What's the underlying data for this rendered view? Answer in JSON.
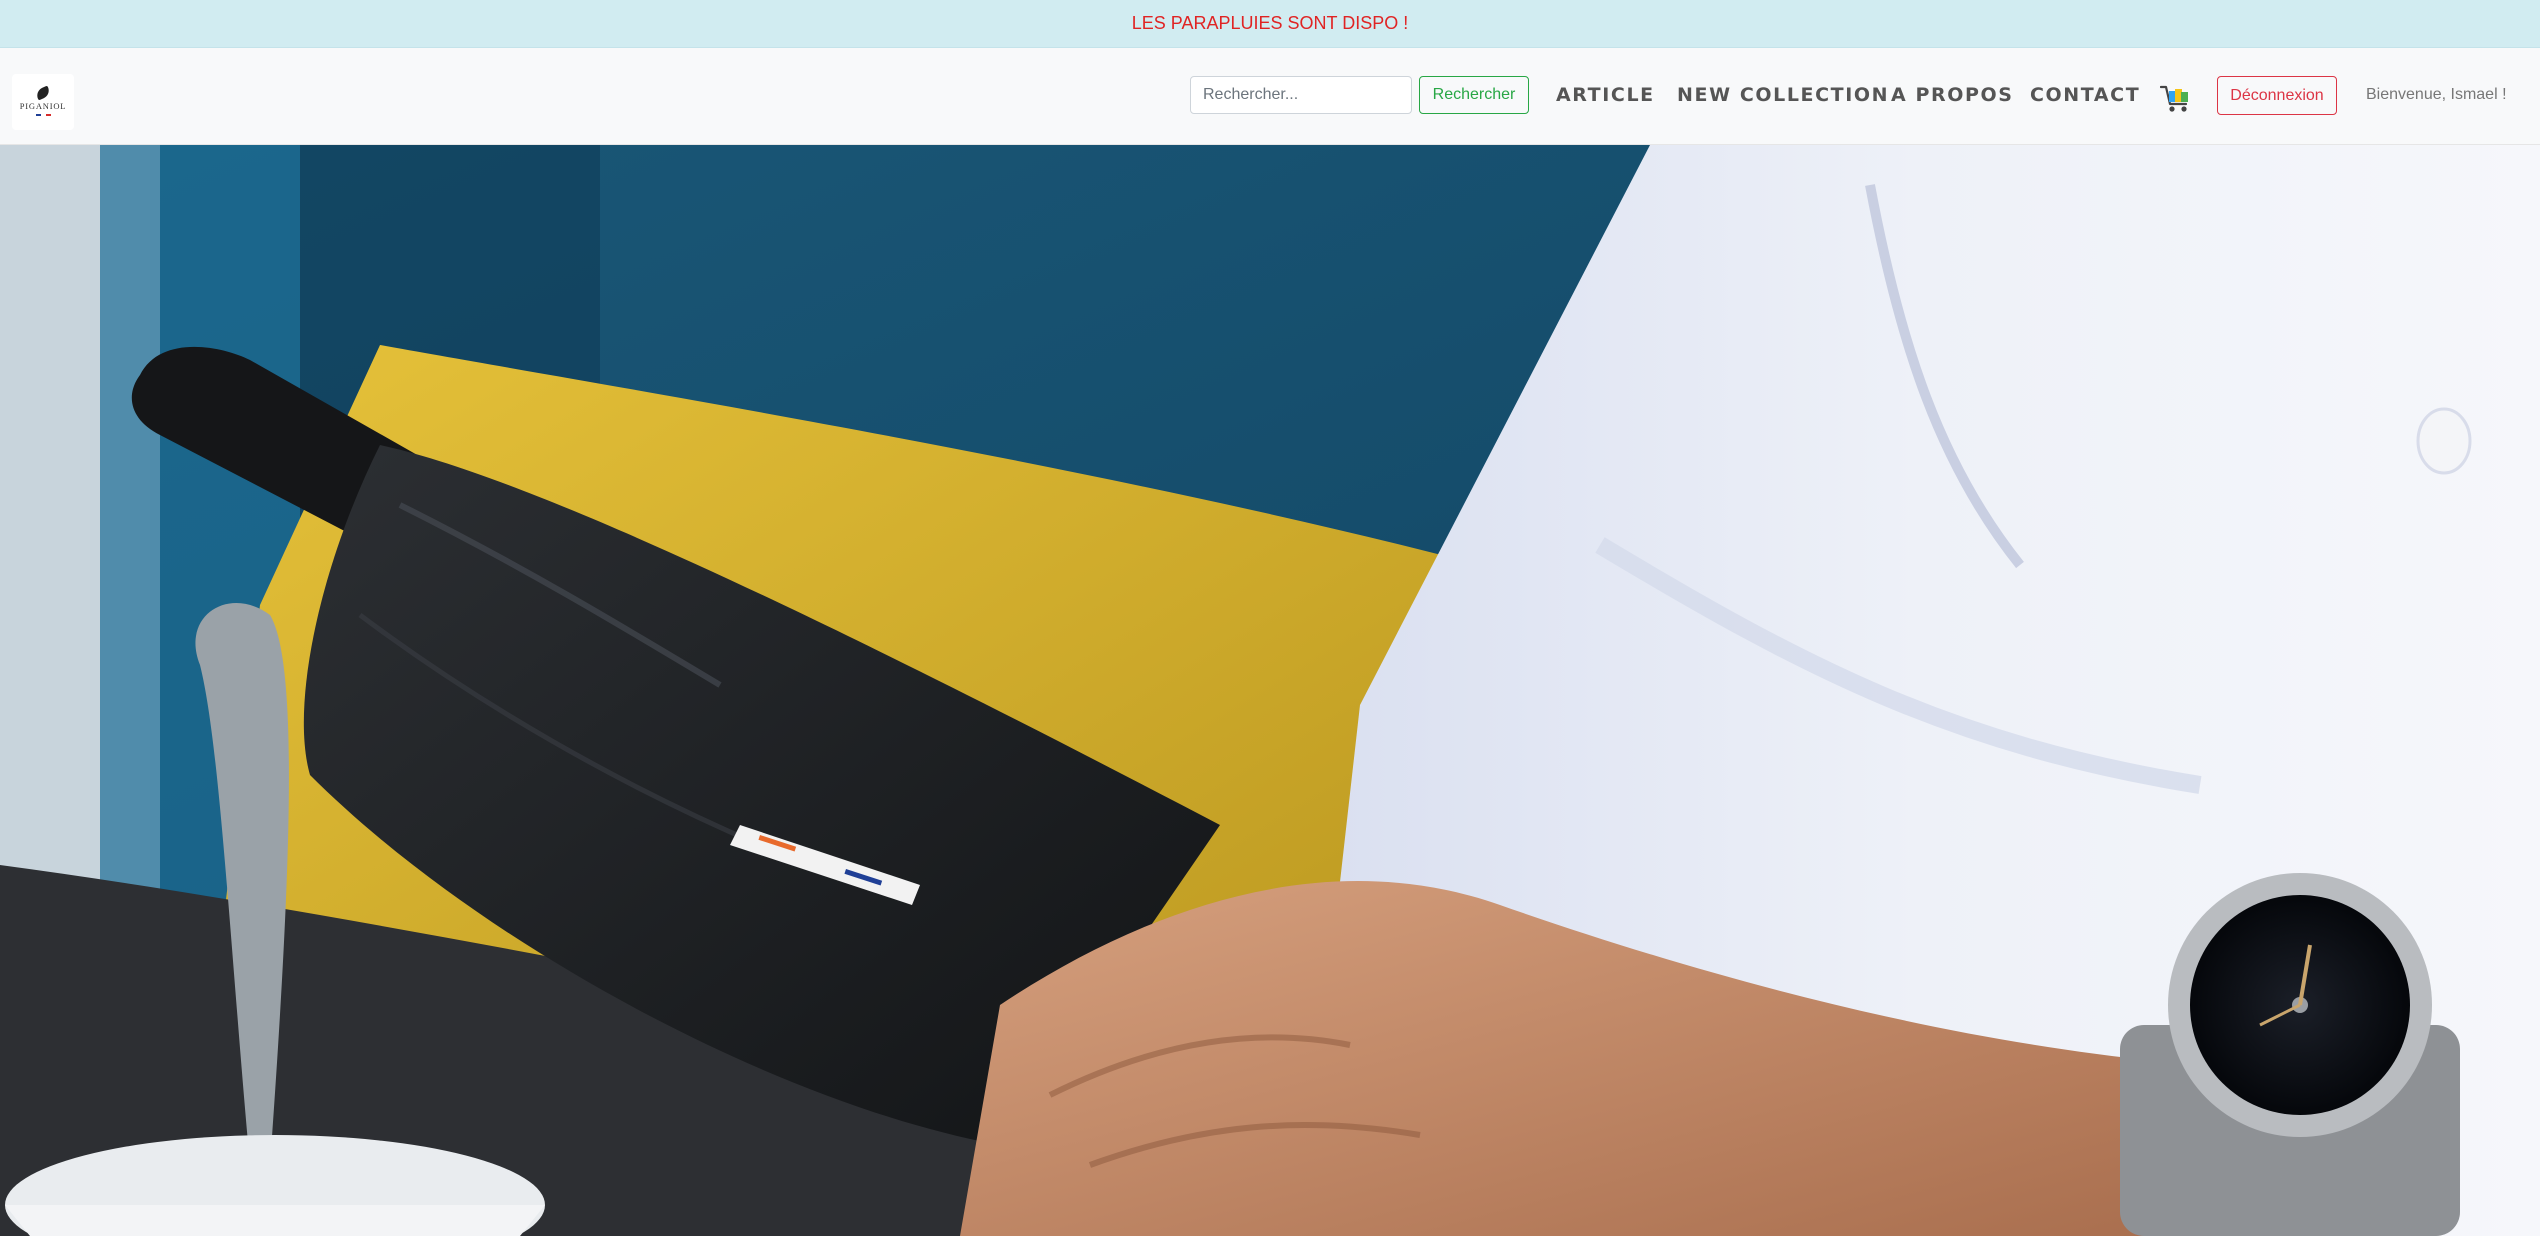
{
  "announcement": {
    "text": "LES PARAPLUIES SONT DISPO !"
  },
  "brand": {
    "name": "PIGANIOL",
    "logo_icon": "feather-icon"
  },
  "search": {
    "placeholder": "Rechercher...",
    "button_label": "Rechercher"
  },
  "nav": {
    "items": [
      {
        "label": "ARTICLE"
      },
      {
        "label": "NEW COLLECTION"
      },
      {
        "label": "A PROPOS"
      },
      {
        "label": "CONTACT"
      }
    ]
  },
  "cart": {
    "icon": "shopping-cart-icon"
  },
  "auth": {
    "logout_label": "Déconnexion",
    "welcome_text": "Bienvenue, Ismael !"
  },
  "hero": {
    "image": "hero-umbrella-photo"
  },
  "colors": {
    "announce_bg": "#d1ecf1",
    "announce_text": "#e02424",
    "success": "#28a745",
    "danger": "#dc3545",
    "navbar_bg": "#f8f9fa"
  }
}
